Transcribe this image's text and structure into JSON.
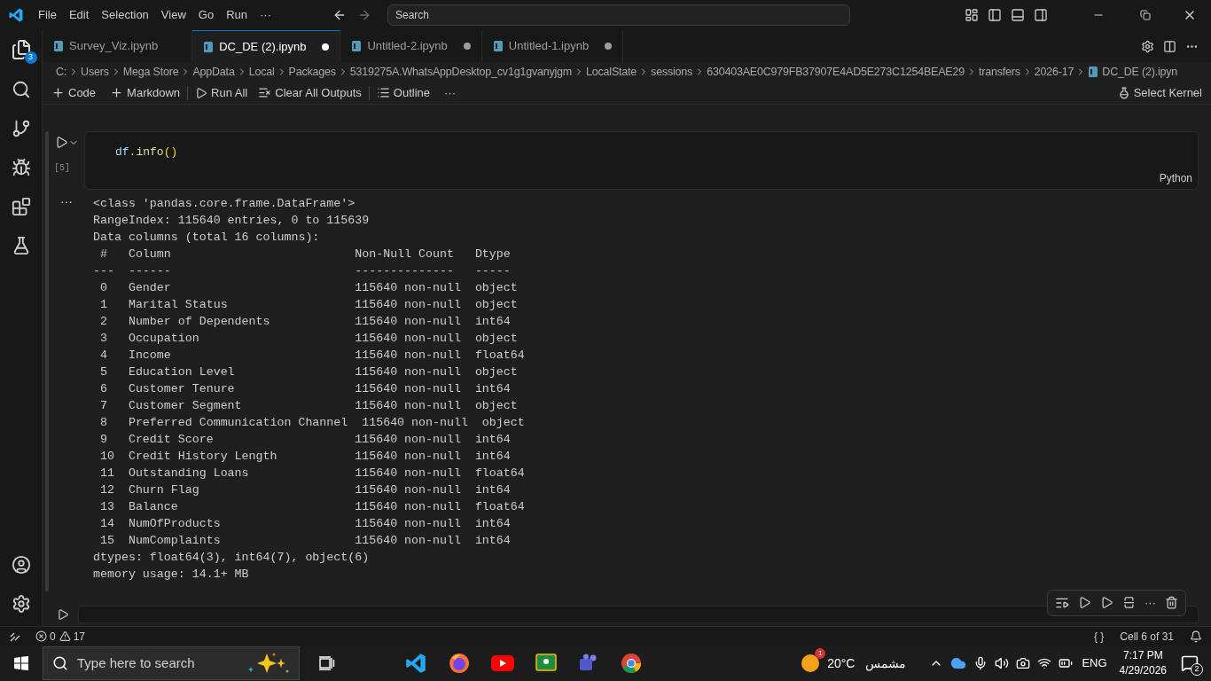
{
  "menu": [
    "File",
    "Edit",
    "Selection",
    "View",
    "Go",
    "Run",
    "···"
  ],
  "search": {
    "placeholder": "Search"
  },
  "activity": {
    "explorer_badge": "3"
  },
  "tabs": [
    {
      "label": "Survey_Viz.ipynb",
      "selected": false,
      "modified": false
    },
    {
      "label": "DC_DE (2).ipynb",
      "selected": true,
      "modified": true
    },
    {
      "label": "Untitled-2.ipynb",
      "selected": false,
      "modified": true
    },
    {
      "label": "Untitled-1.ipynb",
      "selected": false,
      "modified": true
    }
  ],
  "breadcrumb": [
    "C:",
    "Users",
    "Mega Store",
    "AppData",
    "Local",
    "Packages",
    "5319275A.WhatsAppDesktop_cv1g1gvanyjgm",
    "LocalState",
    "sessions",
    "630403AE0C979FB37907E4AD5E273C1254BEAE29",
    "transfers",
    "2026-17",
    "DC_DE (2).ipyn"
  ],
  "toolbar": {
    "code": "Code",
    "markdown": "Markdown",
    "run_all": "Run All",
    "clear": "Clear All Outputs",
    "outline": "Outline",
    "more": "···",
    "kernel": "Select Kernel"
  },
  "cell": {
    "code_obj": "df",
    "code_dot": ".info",
    "code_paren": "()",
    "exec_count": "[5]",
    "language": "Python",
    "output_more": "···",
    "output": [
      "<class 'pandas.core.frame.DataFrame'>",
      "RangeIndex: 115640 entries, 0 to 115639",
      "Data columns (total 16 columns):",
      " #   Column                          Non-Null Count   Dtype  ",
      "---  ------                          --------------   -----  ",
      " 0   Gender                          115640 non-null  object ",
      " 1   Marital Status                  115640 non-null  object ",
      " 2   Number of Dependents            115640 non-null  int64  ",
      " 3   Occupation                      115640 non-null  object ",
      " 4   Income                          115640 non-null  float64",
      " 5   Education Level                 115640 non-null  object ",
      " 6   Customer Tenure                 115640 non-null  int64  ",
      " 7   Customer Segment                115640 non-null  object ",
      " 8   Preferred Communication Channel  115640 non-null  object ",
      " 9   Credit Score                    115640 non-null  int64  ",
      " 10  Credit History Length           115640 non-null  int64  ",
      " 11  Outstanding Loans               115640 non-null  float64",
      " 12  Churn Flag                      115640 non-null  int64  ",
      " 13  Balance                         115640 non-null  float64",
      " 14  NumOfProducts                   115640 non-null  int64  ",
      " 15  NumComplaints                   115640 non-null  int64  ",
      "dtypes: float64(3), int64(7), object(6)",
      "memory usage: 14.1+ MB"
    ]
  },
  "cell_toolbar": {
    "more": "···"
  },
  "status_bar": {
    "errors": "0",
    "warnings": "17",
    "braces": "{ }",
    "cell_position": "Cell 6 of 31"
  },
  "taskbar": {
    "search_placeholder": "Type here to search",
    "weather_badge": "1",
    "temperature": "20°C",
    "weather": "مشمس",
    "language": "ENG",
    "time": "7:17 PM",
    "date": "4/29/2026",
    "notifications": "2"
  }
}
